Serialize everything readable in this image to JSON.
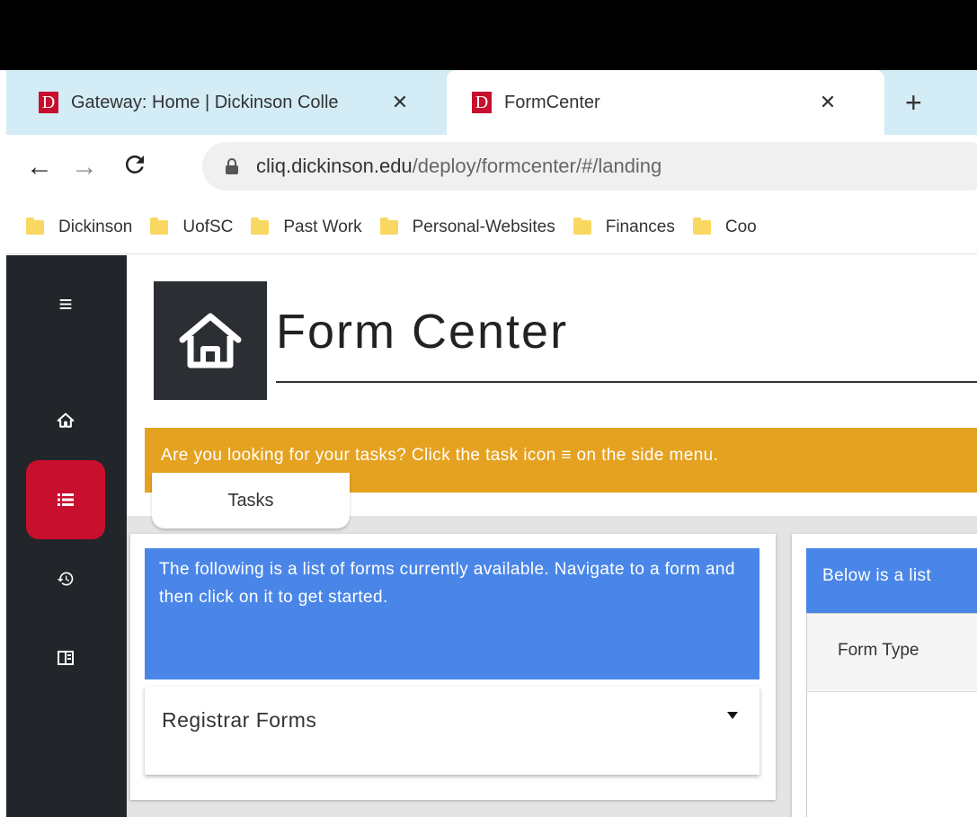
{
  "browser": {
    "tabs": [
      {
        "title": "Gateway: Home | Dickinson Colle",
        "favicon": "D",
        "close": "✕"
      },
      {
        "title": "FormCenter",
        "favicon": "D",
        "close": "✕"
      }
    ],
    "new_tab": "+",
    "address": {
      "domain": "cliq.dickinson.edu",
      "path": "/deploy/formcenter/#/landing"
    },
    "bookmarks": [
      "Dickinson",
      "UofSC",
      "Past Work",
      "Personal-Websites",
      "Finances",
      "Coo"
    ]
  },
  "colors": {
    "brand_red": "#c8102e",
    "sidebar": "#22252a",
    "banner": "#e5a220",
    "info_blue": "#4a86e8"
  },
  "sidebar": {
    "items": [
      {
        "icon": "hamburger-menu-icon"
      },
      {
        "icon": "home-icon"
      },
      {
        "icon": "task-list-icon",
        "active": true
      },
      {
        "icon": "history-icon"
      },
      {
        "icon": "book-icon"
      }
    ]
  },
  "page": {
    "title": "Form Center",
    "banner": "Are you looking for your tasks? Click the task icon ≡ on the side menu.",
    "tasks_tab": "Tasks"
  },
  "left_panel": {
    "info": "The following is a list of forms currently available. Navigate to a form and then click on it to get started.",
    "select_value": "Registrar Forms"
  },
  "right_panel": {
    "info": "Below is a list",
    "column_header": "Form Type"
  }
}
